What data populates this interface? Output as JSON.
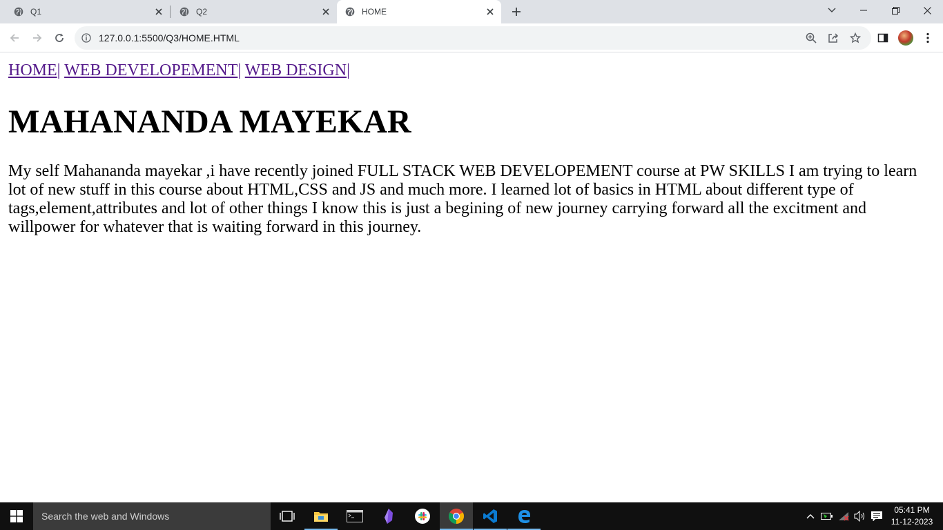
{
  "browser": {
    "tabs": [
      {
        "title": "Q1",
        "active": false
      },
      {
        "title": "Q2",
        "active": false
      },
      {
        "title": "HOME",
        "active": true
      }
    ],
    "address": "127.0.0.1:5500/Q3/HOME.HTML",
    "icons": [
      "back-icon",
      "forward-icon",
      "reload-icon",
      "info-icon",
      "zoom-icon",
      "share-icon",
      "bookmark-star-icon",
      "side-panel-icon",
      "profile-avatar",
      "menu-icon"
    ]
  },
  "page": {
    "nav_links": [
      "HOME",
      "WEB DEVELOPEMENT",
      "WEB DESIGN"
    ],
    "nav_separator": "|",
    "heading": "MAHANANDA MAYEKAR",
    "paragraph": "My self Mahananda mayekar ,i have recently joined FULL STACK WEB DEVELOPEMENT course at PW SKILLS I am trying to learn lot of new stuff in this course about HTML,CSS and JS and much more. I learned lot of basics in HTML about different type of tags,element,attributes and lot of other things I know this is just a begining of new journey carrying forward all the excitment and willpower for whatever that is waiting forward in this journey.",
    "link_color": "#551a8b"
  },
  "taskbar": {
    "search_placeholder": "Search the web and Windows",
    "time": "05:41 PM",
    "date": "11-12-2023",
    "apps": [
      "task-view",
      "file-explorer",
      "terminal",
      "obsidian",
      "slack",
      "chrome",
      "vscode",
      "edge"
    ]
  }
}
